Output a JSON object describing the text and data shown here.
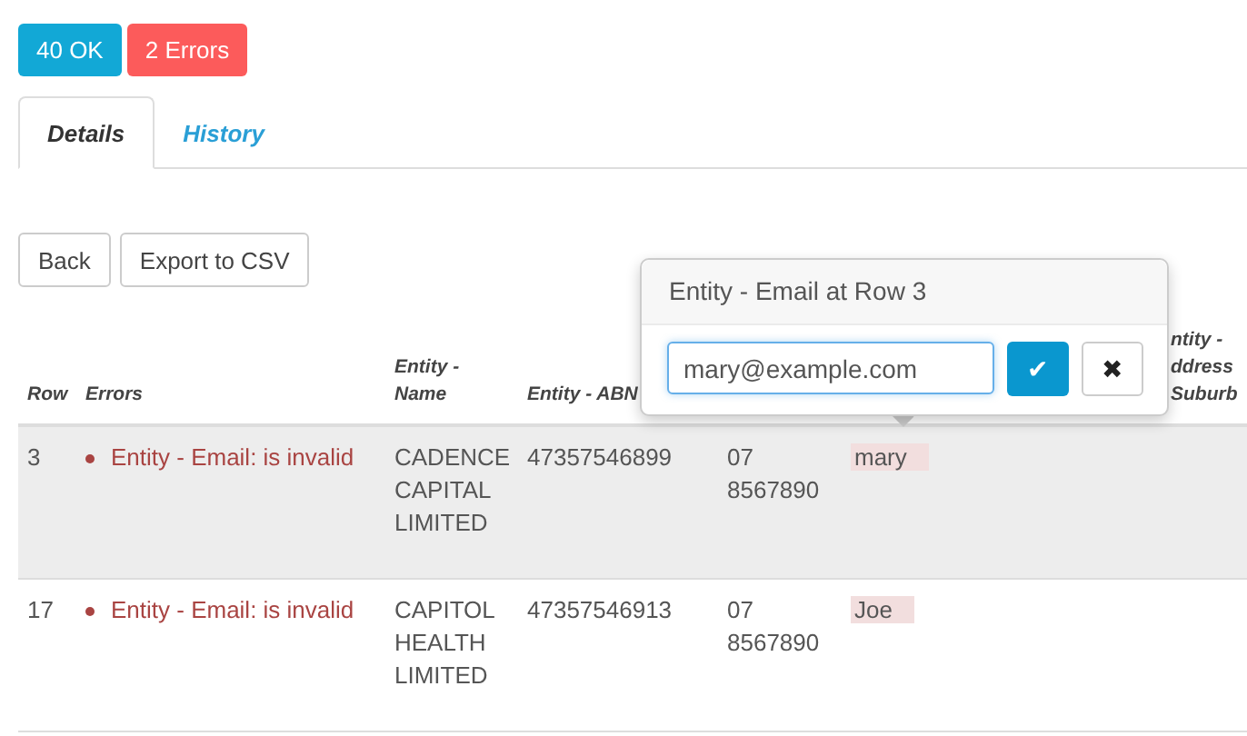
{
  "badges": [
    {
      "label": "40 OK",
      "kind": "ok"
    },
    {
      "label": "2 Errors",
      "kind": "error"
    }
  ],
  "tabs": [
    {
      "label": "Details",
      "selected": true
    },
    {
      "label": "History",
      "selected": false
    }
  ],
  "buttons": [
    "Back",
    "Export to CSV"
  ],
  "table": {
    "columns": [
      "Row",
      "Errors",
      "Entity - Name",
      "Entity - ABN",
      "",
      "",
      "ntity - ddress Suburb"
    ],
    "rows": [
      {
        "row": "3",
        "errors": [
          "Entity - Email: is invalid"
        ],
        "name": "CADENCE CAPITAL LIMITED",
        "abn": "47357546899",
        "column_5": "07 8567890",
        "column_6": "mary",
        "column_6_invalid": true,
        "selected": true
      },
      {
        "row": "17",
        "errors": [
          "Entity - Email: is invalid"
        ],
        "name": "CAPITOL HEALTH LIMITED",
        "abn": "47357546913",
        "column_5": "07 8567890",
        "column_6": "Joe",
        "column_6_invalid": true,
        "selected": false
      }
    ]
  },
  "popover": {
    "title": "Entity - Email at Row 3",
    "value": "mary@example.com",
    "confirm": "✔",
    "cancel": "✖"
  }
}
